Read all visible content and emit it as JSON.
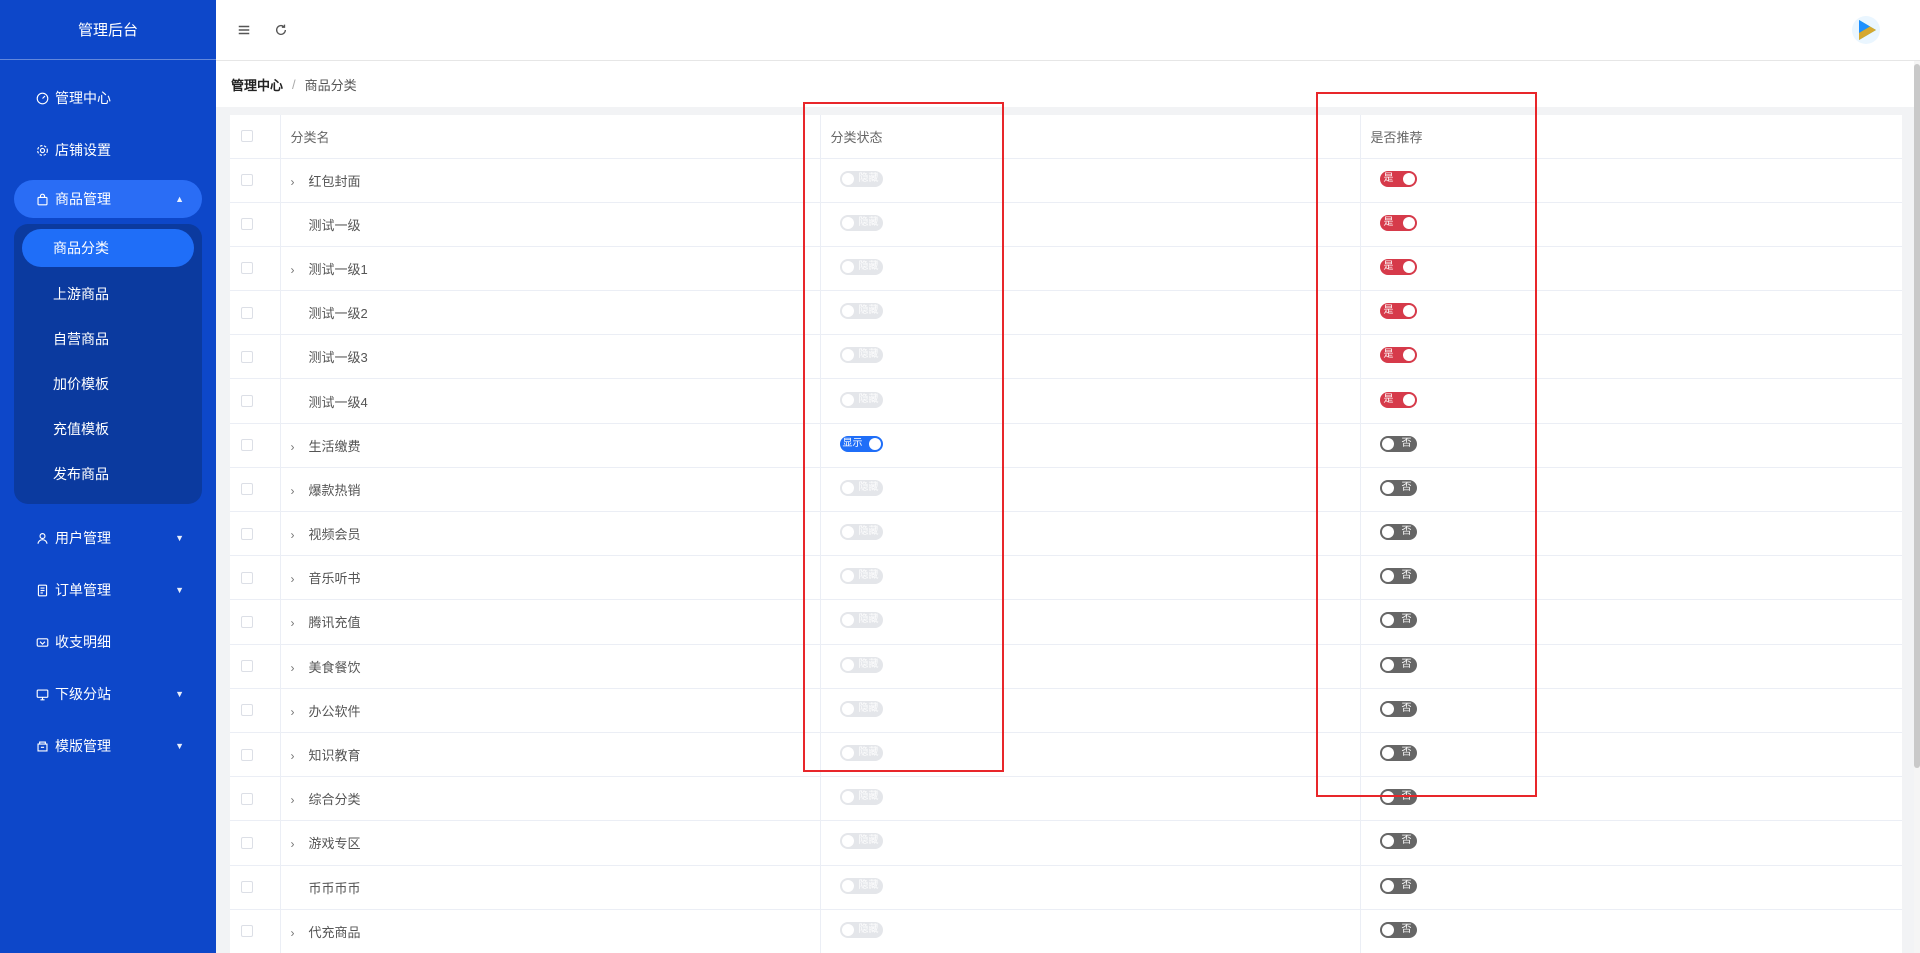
{
  "app": {
    "brand": "管理后台"
  },
  "sidebar": {
    "items": [
      {
        "label": "管理中心",
        "icon": "dashboard-icon"
      },
      {
        "label": "店铺设置",
        "icon": "gear-icon"
      },
      {
        "label": "商品管理",
        "icon": "bag-icon",
        "expanded": true
      },
      {
        "label": "用户管理",
        "icon": "user-icon"
      },
      {
        "label": "订单管理",
        "icon": "order-icon"
      },
      {
        "label": "收支明细",
        "icon": "wallet-icon"
      },
      {
        "label": "下级分站",
        "icon": "monitor-icon"
      },
      {
        "label": "模版管理",
        "icon": "template-icon"
      }
    ],
    "submenu": [
      {
        "label": "商品分类",
        "active": true
      },
      {
        "label": "上游商品"
      },
      {
        "label": "自营商品"
      },
      {
        "label": "加价模板"
      },
      {
        "label": "充值模板"
      },
      {
        "label": "发布商品"
      }
    ]
  },
  "header": {
    "menu_icon": "hamburger-icon",
    "refresh_icon": "refresh-icon"
  },
  "breadcrumb": {
    "root": "管理中心",
    "separator": "/",
    "current": "商品分类"
  },
  "table": {
    "columns": {
      "name": "分类名",
      "status": "分类状态",
      "recommend": "是否推荐"
    },
    "rows": [
      {
        "name": "红包封面",
        "expandable": true,
        "status": "隐藏",
        "recommend": "是"
      },
      {
        "name": "测试一级",
        "expandable": false,
        "status": "隐藏",
        "recommend": "是"
      },
      {
        "name": "测试一级1",
        "expandable": true,
        "status": "隐藏",
        "recommend": "是"
      },
      {
        "name": "测试一级2",
        "expandable": false,
        "status": "隐藏",
        "recommend": "是"
      },
      {
        "name": "测试一级3",
        "expandable": false,
        "status": "隐藏",
        "recommend": "是"
      },
      {
        "name": "测试一级4",
        "expandable": false,
        "status": "隐藏",
        "recommend": "是"
      },
      {
        "name": "生活缴费",
        "expandable": true,
        "status": "显示",
        "recommend": "否"
      },
      {
        "name": "爆款热销",
        "expandable": true,
        "status": "隐藏",
        "recommend": "否"
      },
      {
        "name": "视频会员",
        "expandable": true,
        "status": "隐藏",
        "recommend": "否"
      },
      {
        "name": "音乐听书",
        "expandable": true,
        "status": "隐藏",
        "recommend": "否"
      },
      {
        "name": "腾讯充值",
        "expandable": true,
        "status": "隐藏",
        "recommend": "否"
      },
      {
        "name": "美食餐饮",
        "expandable": true,
        "status": "隐藏",
        "recommend": "否"
      },
      {
        "name": "办公软件",
        "expandable": true,
        "status": "隐藏",
        "recommend": "否"
      },
      {
        "name": "知识教育",
        "expandable": true,
        "status": "隐藏",
        "recommend": "否"
      },
      {
        "name": "综合分类",
        "expandable": true,
        "status": "隐藏",
        "recommend": "否"
      },
      {
        "name": "游戏专区",
        "expandable": true,
        "status": "隐藏",
        "recommend": "否"
      },
      {
        "name": "币币币币",
        "expandable": false,
        "status": "隐藏",
        "recommend": "否"
      },
      {
        "name": "代充商品",
        "expandable": true,
        "status": "隐藏",
        "recommend": "否"
      }
    ]
  },
  "colors": {
    "sidebar_bg": "#0d47c9",
    "accent": "#1f6ef8",
    "recommend_on": "#d63a4a",
    "recommend_off": "#666666",
    "annotation": "#e8262a"
  }
}
